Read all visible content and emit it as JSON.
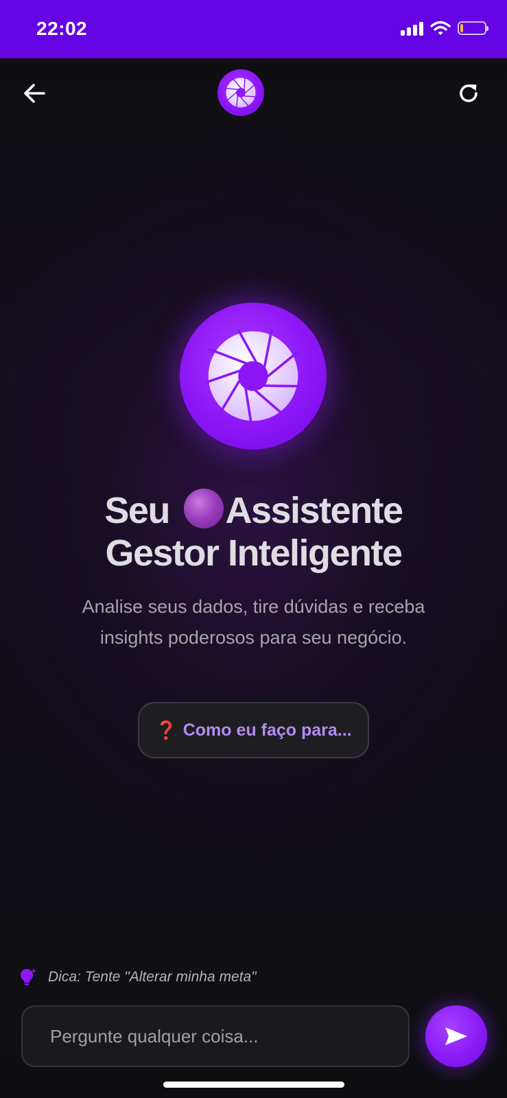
{
  "status_bar": {
    "time": "22:02",
    "background_color": "#6505e3",
    "icons": [
      "signal-icon",
      "wifi-icon",
      "battery-icon"
    ],
    "battery_level": 0.12,
    "battery_color": "#f6b54a"
  },
  "header": {
    "back_icon": "arrow-left-icon",
    "logo_icon": "aperture-logo-icon",
    "refresh_icon": "refresh-icon"
  },
  "hero": {
    "logo_icon": "aperture-logo-icon",
    "title_part1": "Seu ",
    "title_emoji": "purple-circle-emoji",
    "title_part2": "Assistente",
    "title_line2": "Gestor Inteligente",
    "subtitle": "Analise seus dados, tire dúvidas e receba insights poderosos para seu negócio."
  },
  "suggestion": {
    "icon_glyph": "❓",
    "label": "Como eu faço para..."
  },
  "tip": {
    "icon": "lightbulb-icon",
    "text": "Dica: Tente \"Alterar minha meta\""
  },
  "input": {
    "placeholder": "Pergunte qualquer coisa...",
    "value": ""
  },
  "send": {
    "icon": "send-icon"
  },
  "colors": {
    "accent": "#8c17f7",
    "background": "#0f0f12",
    "chip_text": "#b58af3"
  }
}
